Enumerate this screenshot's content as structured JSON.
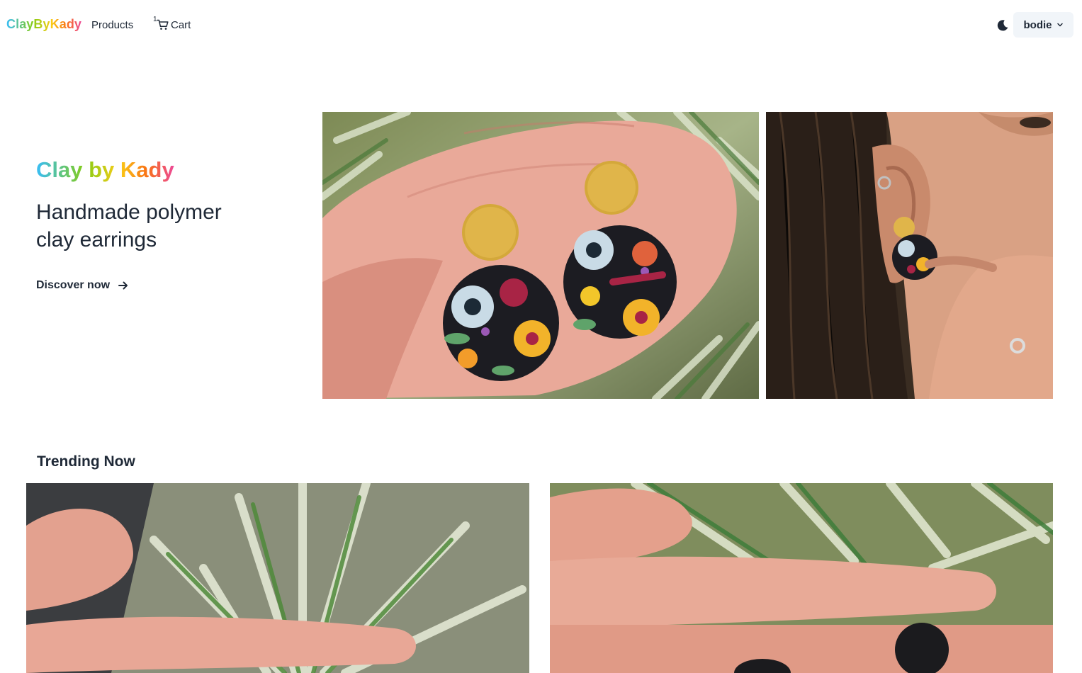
{
  "nav": {
    "brand": "ClayByKady",
    "products_label": "Products",
    "cart_label": "Cart",
    "cart_count": "1",
    "user_name": "bodie"
  },
  "hero": {
    "title": "Clay by Kady",
    "subtitle": "Handmade polymer clay earrings",
    "cta_label": "Discover now"
  },
  "trending": {
    "title": "Trending Now"
  },
  "colors": {
    "text": "#1f2937",
    "user_button_bg": "#f1f5f9",
    "brand_gradient": [
      "#38bdf8",
      "#84cc16",
      "#facc15",
      "#f97316",
      "#ec4899"
    ]
  },
  "icons": [
    "cart-icon",
    "moon-icon",
    "chevron-down-icon",
    "arrow-right-icon"
  ]
}
